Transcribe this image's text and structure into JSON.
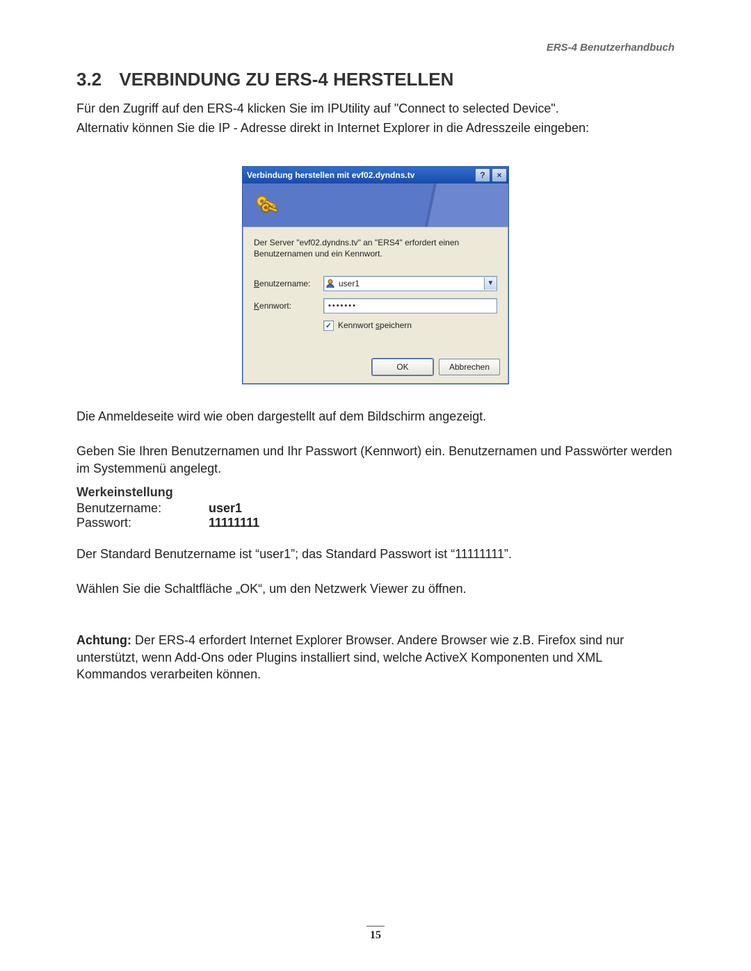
{
  "header": {
    "running": "ERS-4  Benutzerhandbuch"
  },
  "section": {
    "number": "3.2",
    "title": "VERBINDUNG ZU ERS-4 HERSTELLEN"
  },
  "intro": {
    "line1": "Für den Zugriff auf den ERS-4 klicken Sie im IPUtility auf \"Connect to selected Device\".",
    "line2": "Alternativ können Sie die IP - Adresse direkt in Internet Explorer in die Adresszeile eingeben:"
  },
  "dialog": {
    "title": "Verbindung herstellen mit evf02.dyndns.tv",
    "help_btn": "?",
    "close_btn": "×",
    "info": "Der Server \"evf02.dyndns.tv\" an \"ERS4\" erfordert einen Benutzernamen und ein Kennwort.",
    "user_label_pre": "B",
    "user_label_rest": "enutzername:",
    "user_value": "user1",
    "pass_label_pre": "K",
    "pass_label_rest": "ennwort:",
    "pass_value": "•••••••",
    "remember_pre": "Kennwort ",
    "remember_ul": "s",
    "remember_rest": "peichern",
    "ok": "OK",
    "cancel": "Abbrechen"
  },
  "after": {
    "p1": "Die Anmeldeseite wird wie oben dargestellt auf dem Bildschirm angezeigt.",
    "p2": "Geben Sie Ihren Benutzernamen und Ihr Passwort (Kennwort) ein. Benutzernamen und Passwörter werden im Systemmenü angelegt."
  },
  "defaults": {
    "heading": "Werkeinstellung",
    "user_label": "Benutzername:",
    "user_value": "user1",
    "pass_label": "Passwort:",
    "pass_value": "11111111"
  },
  "notes": {
    "p1": "Der Standard Benutzername ist “user1”; das Standard Passwort ist “11111111”.",
    "p2": "Wählen Sie die Schaltfläche „OK“, um den Netzwerk Viewer zu öffnen.",
    "warn_label": "Achtung:",
    "warn_text": " Der ERS-4 erfordert Internet Explorer Browser. Andere Browser wie z.B. Firefox sind nur unterstützt, wenn Add-Ons oder Plugins  installiert sind, welche ActiveX Komponenten und XML Kommandos verarbeiten können."
  },
  "page_number": "15"
}
